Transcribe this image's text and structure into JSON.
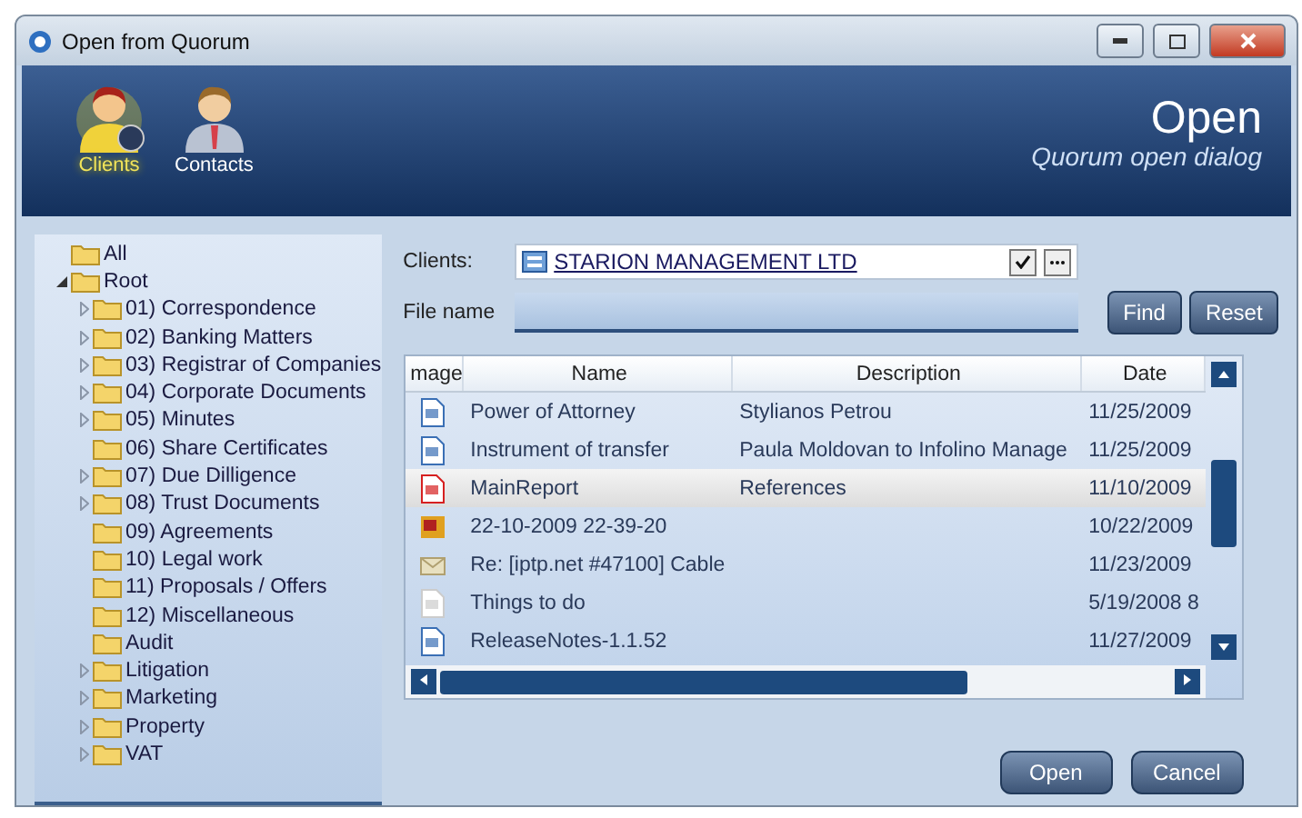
{
  "window": {
    "title": "Open from Quorum"
  },
  "nav": [
    {
      "label": "Clients",
      "selected": true,
      "kind": "client"
    },
    {
      "label": "Contacts",
      "selected": false,
      "kind": "contact"
    }
  ],
  "header": {
    "title": "Open",
    "subtitle": "Quorum open dialog"
  },
  "tree": [
    {
      "label": "All"
    },
    {
      "label": "Root",
      "expanded": true,
      "children": [
        {
          "label": "01) Correspondence",
          "expanded": false
        },
        {
          "label": "02) Banking Matters",
          "expanded": false
        },
        {
          "label": "03) Registrar of Companies",
          "expanded": false
        },
        {
          "label": "04) Corporate Documents",
          "expanded": false
        },
        {
          "label": "05) Minutes",
          "expanded": false
        },
        {
          "label": "06) Share Certificates"
        },
        {
          "label": "07) Due Dilligence",
          "expanded": false
        },
        {
          "label": "08) Trust Documents",
          "expanded": false
        },
        {
          "label": "09) Agreements"
        },
        {
          "label": "10) Legal work"
        },
        {
          "label": "11) Proposals / Offers"
        },
        {
          "label": "12) Miscellaneous"
        },
        {
          "label": "Audit"
        },
        {
          "label": "Litigation",
          "expanded": false
        },
        {
          "label": "Marketing",
          "expanded": false
        },
        {
          "label": "Property",
          "expanded": false
        },
        {
          "label": "VAT",
          "expanded": false
        }
      ]
    }
  ],
  "form": {
    "clients_label": "Clients:",
    "client_value": "STARION MANAGEMENT LTD",
    "file_name_label": "File name",
    "find_button": "Find",
    "reset_button": "Reset"
  },
  "table": {
    "columns": [
      "mage",
      "Name",
      "Description",
      "Date"
    ],
    "rows": [
      {
        "kind": "doc",
        "name": "Power of Attorney",
        "description": "Stylianos Petrou",
        "date": "11/25/2009",
        "selected": false
      },
      {
        "kind": "doc",
        "name": "Instrument of transfer",
        "description": "Paula Moldovan to Infolino Manage",
        "date": "11/25/2009",
        "selected": false
      },
      {
        "kind": "pdf",
        "name": "MainReport",
        "description": "References",
        "date": "11/10/2009",
        "selected": true
      },
      {
        "kind": "image",
        "name": "22-10-2009 22-39-20",
        "description": "",
        "date": "10/22/2009",
        "selected": false
      },
      {
        "kind": "mail",
        "name": "Re: [iptp.net #47100] Cable",
        "description": "",
        "date": "11/23/2009",
        "selected": false
      },
      {
        "kind": "blank",
        "name": "Things to do",
        "description": "",
        "date": "5/19/2008 8",
        "selected": false
      },
      {
        "kind": "doc",
        "name": "ReleaseNotes-1.1.52",
        "description": "",
        "date": "11/27/2009",
        "selected": false
      }
    ]
  },
  "buttons": [
    "Open",
    "Cancel"
  ]
}
